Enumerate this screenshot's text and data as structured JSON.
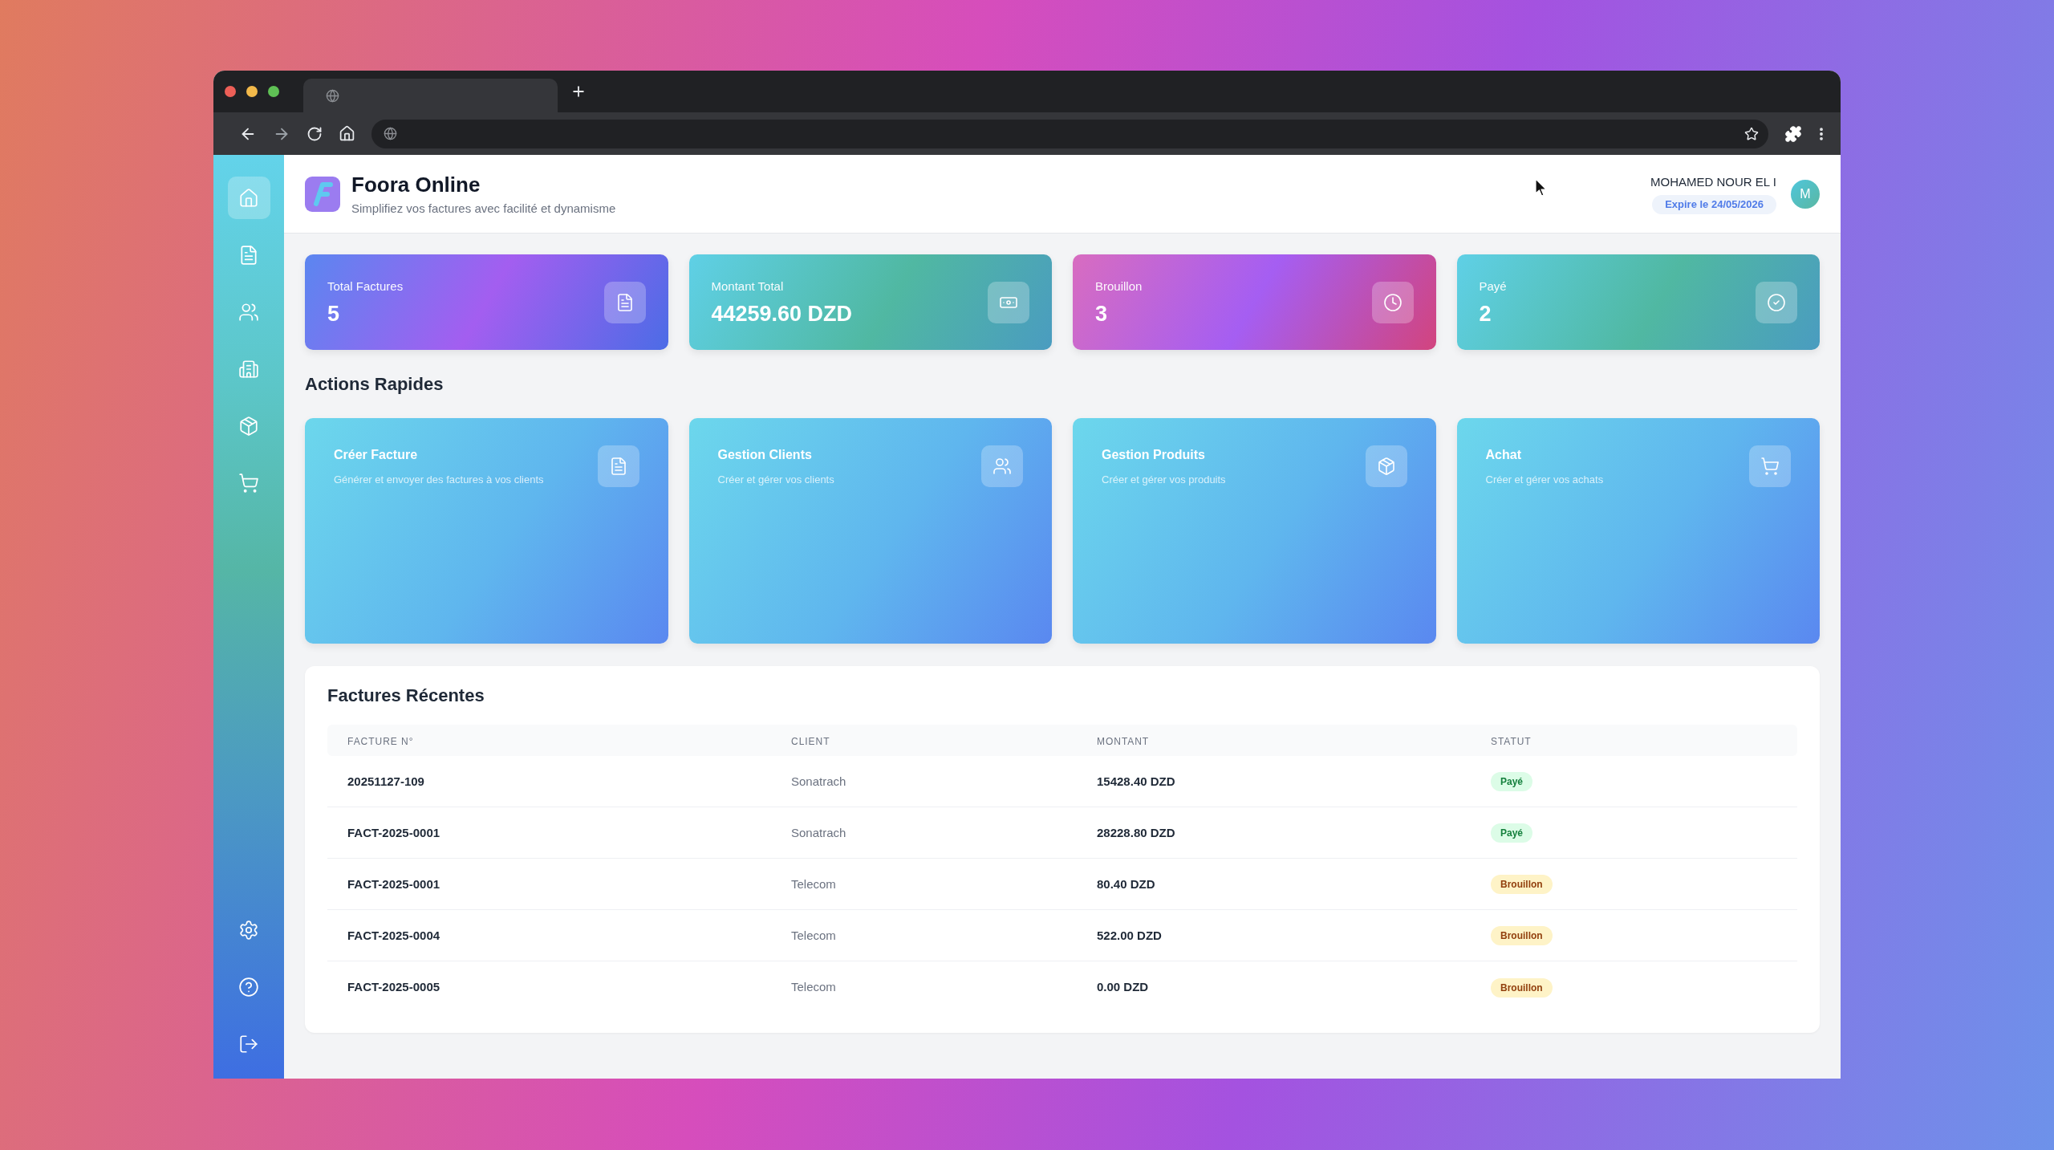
{
  "sidebar": {
    "items": [
      {
        "kind": "home",
        "selected": true
      },
      {
        "kind": "document",
        "selected": false
      },
      {
        "kind": "users",
        "selected": false
      },
      {
        "kind": "building",
        "selected": false
      },
      {
        "kind": "box",
        "selected": false
      },
      {
        "kind": "cart",
        "selected": false
      }
    ],
    "bottom_items": [
      {
        "kind": "settings"
      },
      {
        "kind": "help"
      },
      {
        "kind": "logout"
      }
    ]
  },
  "header": {
    "title": "Foora Online",
    "subtitle": "Simplifiez vos factures avec facilité et dynamisme",
    "user": {
      "name": "MOHAMED NOUR EL I",
      "expiry": "Expire le 24/05/2026",
      "avatar": "M"
    }
  },
  "stats": [
    {
      "kind": "invoices",
      "label": "Total Factures",
      "value": "5"
    },
    {
      "kind": "amount",
      "label": "Montant Total",
      "value": "44259.60 DZD"
    },
    {
      "kind": "draft",
      "label": "Brouillon",
      "value": "3"
    },
    {
      "kind": "paid",
      "label": "Payé",
      "value": "2"
    }
  ],
  "quick_actions": {
    "title": "Actions Rapides",
    "items": [
      {
        "kind": "document",
        "title": "Créer Facture",
        "description": "Générer et envoyer des factures à vos clients"
      },
      {
        "kind": "users",
        "title": "Gestion Clients",
        "description": "Créer et gérer vos clients"
      },
      {
        "kind": "box",
        "title": "Gestion Produits",
        "description": "Créer et gérer vos produits"
      },
      {
        "kind": "cart",
        "title": "Achat",
        "description": "Créer et gérer vos achats"
      }
    ]
  },
  "recent_invoices": {
    "title": "Factures Récentes",
    "columns": [
      "FACTURE N°",
      "CLIENT",
      "MONTANT",
      "STATUT"
    ],
    "rows": [
      {
        "number": "20251127-109",
        "client": "Sonatrach",
        "amount": "15428.40 DZD",
        "status": {
          "kind": "paid",
          "label": "Payé"
        }
      },
      {
        "number": "FACT-2025-0001",
        "client": "Sonatrach",
        "amount": "28228.80 DZD",
        "status": {
          "kind": "paid",
          "label": "Payé"
        }
      },
      {
        "number": "FACT-2025-0001",
        "client": "Telecom",
        "amount": "80.40 DZD",
        "status": {
          "kind": "draft",
          "label": "Brouillon"
        }
      },
      {
        "number": "FACT-2025-0004",
        "client": "Telecom",
        "amount": "522.00 DZD",
        "status": {
          "kind": "draft",
          "label": "Brouillon"
        }
      },
      {
        "number": "FACT-2025-0005",
        "client": "Telecom",
        "amount": "0.00 DZD",
        "status": {
          "kind": "draft",
          "label": "Brouillon"
        }
      }
    ]
  }
}
